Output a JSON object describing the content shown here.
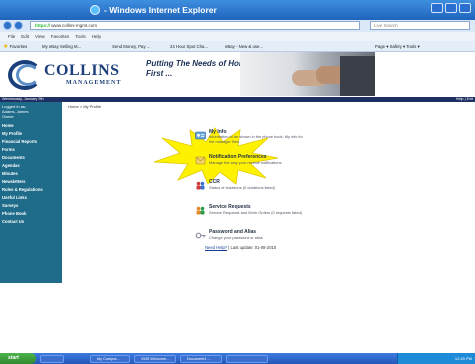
{
  "window": {
    "title": "- Windows Internet Explorer"
  },
  "address": {
    "url_prefix": "https://",
    "url": "www.collins-mgmt.com",
    "search_placeholder": "Live Search"
  },
  "menu": [
    "File",
    "Edit",
    "View",
    "Favorites",
    "Tools",
    "Help"
  ],
  "favorites": {
    "label": "Favorites",
    "items": [
      "My eBay Selling M...",
      "Send Money, Pay ...",
      "24 Hour Spot Cha...",
      "eBay - New & use..."
    ],
    "tools": "Page ▾  Safety ▾  Tools ▾"
  },
  "site": {
    "logo_name": "COLLINS",
    "logo_sub": "MANAGEMENT",
    "tagline": "Putting The Needs of Homeowners First ...",
    "date": "Wednesday, January 9th",
    "help": "Help",
    "exit": "Exit"
  },
  "sidenav": {
    "logged_label": "Logged in as:",
    "user_name": "Adams, James",
    "role": "Owner",
    "items": [
      "Home",
      "My Profile",
      "Financial Reports",
      "Forms",
      "Documents",
      "Agendas",
      "Minutes",
      "Newsletters",
      "Rules & Regulations",
      "Useful Links",
      "Surveys",
      "Phone Book",
      "Contact Us"
    ]
  },
  "breadcrumb": "Home > My Profile",
  "entries": [
    {
      "title": "My Info",
      "desc": "Information to be shown in the phone book. My info for the manager files."
    },
    {
      "title": "Notification Preferences",
      "desc": "Manage the way your receive notifications."
    },
    {
      "title": "CCR",
      "desc": "Status of violations (0 violations listed)"
    },
    {
      "title": "Service Requests",
      "desc": "Service Requests and Work Orders (0 requests listed)"
    },
    {
      "title": "Password and Alias",
      "desc": "Change your password or alias"
    }
  ],
  "footer": {
    "link": "Need Help?",
    "text": "| Last update: 01-08-2010"
  },
  "taskbar": {
    "start": "start",
    "tasks": [
      "",
      "My Comput...",
      "VMS Welcome...",
      "Document1 ...",
      ""
    ],
    "clock": "12:45 PM"
  },
  "colors": {
    "nav_bg": "#1e6b8a",
    "strip_bg": "#1e2f64",
    "brand": "#1a3f7a",
    "burst": "#fff200"
  }
}
